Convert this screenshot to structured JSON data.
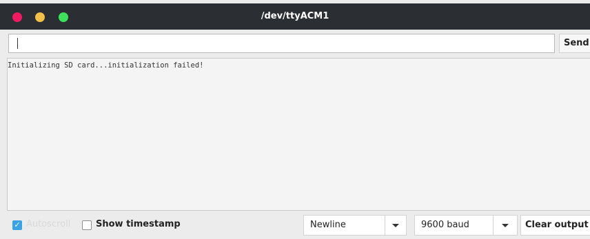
{
  "window": {
    "title": "/dev/ttyACM1"
  },
  "input": {
    "value": "",
    "send_label": "Send"
  },
  "output": {
    "lines": [
      "Initializing SD card...initialization failed!"
    ]
  },
  "footer": {
    "autoscroll_label": "Autoscroll",
    "autoscroll_checked": true,
    "timestamp_label": "Show timestamp",
    "timestamp_checked": false,
    "line_ending": "Newline",
    "baud": "9600 baud",
    "clear_label": "Clear output"
  },
  "colors": {
    "titlebar": "#2b2e33",
    "close": "#ee1b61",
    "minimize": "#f5c04a",
    "maximize": "#3ee25a",
    "checkbox_accent": "#3aa3e3"
  }
}
